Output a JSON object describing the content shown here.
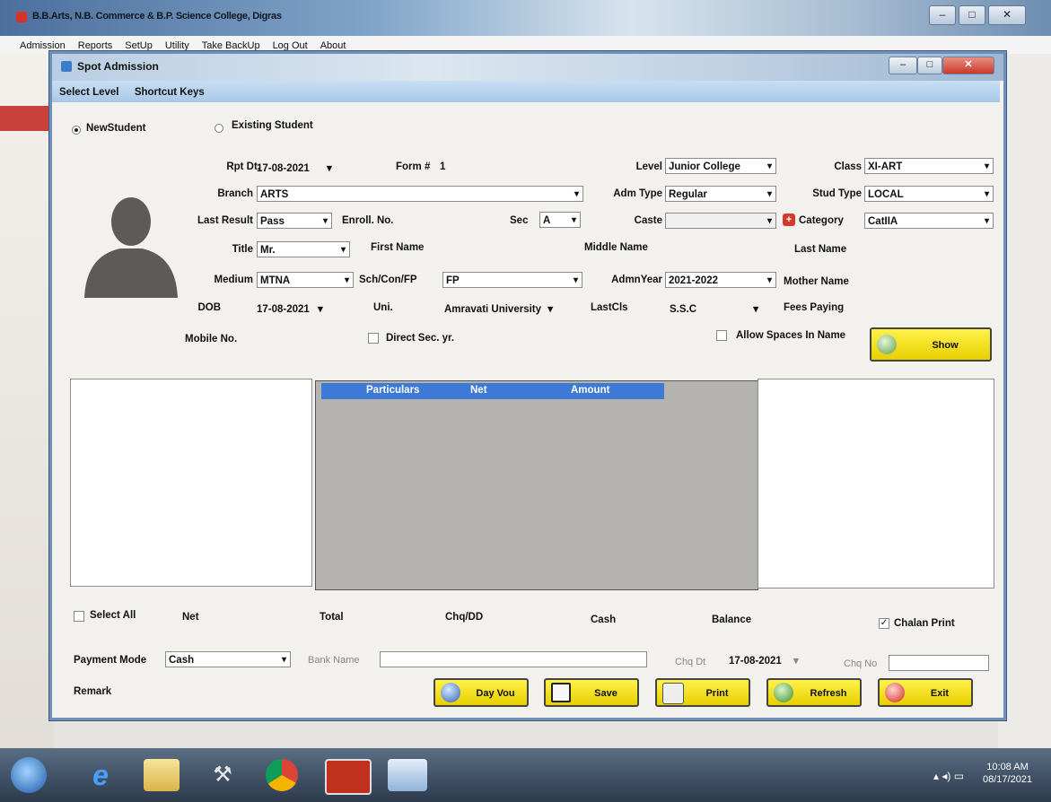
{
  "app": {
    "title": "B.B.Arts, N.B. Commerce & B.P. Science College, Digras",
    "menu": [
      "Admission",
      "Reports",
      "SetUp",
      "Utility",
      "Take BackUp",
      "Log Out",
      "About"
    ]
  },
  "dialog": {
    "title": "Spot Admission",
    "menu": [
      "Select Level",
      "Shortcut Keys"
    ]
  },
  "student_type": {
    "new": "NewStudent",
    "existing": "Existing Student",
    "selected": "new"
  },
  "form": {
    "rpt_dt_label": "Rpt Dt.",
    "rpt_dt": "17-08-2021",
    "form_no_label": "Form #",
    "form_no": "1",
    "level_label": "Level",
    "level": "Junior College",
    "class_label": "Class",
    "class": "XI-ART",
    "branch_label": "Branch",
    "branch": "ARTS",
    "adm_type_label": "Adm Type",
    "adm_type": "Regular",
    "stud_type_label": "Stud Type",
    "stud_type": "LOCAL",
    "last_result_label": "Last Result",
    "last_result": "Pass",
    "enroll_label": "Enroll. No.",
    "sec_label": "Sec",
    "sec": "A",
    "caste_label": "Caste",
    "caste": "",
    "category_label": "Category",
    "category": "CatIIA",
    "title_label": "Title",
    "title": "Mr.",
    "first_name_label": "First Name",
    "middle_name_label": "Middle Name",
    "last_name_label": "Last Name",
    "medium_label": "Medium",
    "medium": "MTNA",
    "sch_label": "Sch/Con/FP",
    "sch": "FP",
    "admn_year_label": "AdmnYear",
    "admn_year": "2021-2022",
    "mother_name_label": "Mother Name",
    "dob_label": "DOB",
    "dob": "17-08-2021",
    "uni_label": "Uni.",
    "uni": "Amravati University",
    "last_cls_label": "LastCls",
    "last_cls": "S.S.C",
    "fees_paying_label": "Fees Paying",
    "mobile_label": "Mobile No.",
    "direct_sec_label": "Direct Sec. yr.",
    "allow_spaces_label": "Allow Spaces In Name",
    "show_label": "Show"
  },
  "fees_table": {
    "columns": [
      "Particulars",
      "Net",
      "Amount"
    ]
  },
  "totals": {
    "select_all": "Select All",
    "net": "Net",
    "total": "Total",
    "chq_dd": "Chq/DD",
    "cash": "Cash",
    "balance": "Balance",
    "chalan_print": "Chalan Print",
    "chalan_checked": true
  },
  "payment": {
    "mode_label": "Payment Mode",
    "mode": "Cash",
    "bank_label": "Bank Name",
    "chq_dt_label": "Chq Dt",
    "chq_dt": "17-08-2021",
    "chq_no_label": "Chq No",
    "remark_label": "Remark"
  },
  "buttons": {
    "day_vou": "Day Vou",
    "save": "Save",
    "print": "Print",
    "refresh": "Refresh",
    "exit": "Exit"
  },
  "taskbar": {
    "time": "10:08 AM",
    "date": "08/17/2021"
  },
  "colors": {
    "accent_yellow": "#f5e21a",
    "header_blue": "#3d7ad6",
    "bg_red": "#c9413b"
  }
}
